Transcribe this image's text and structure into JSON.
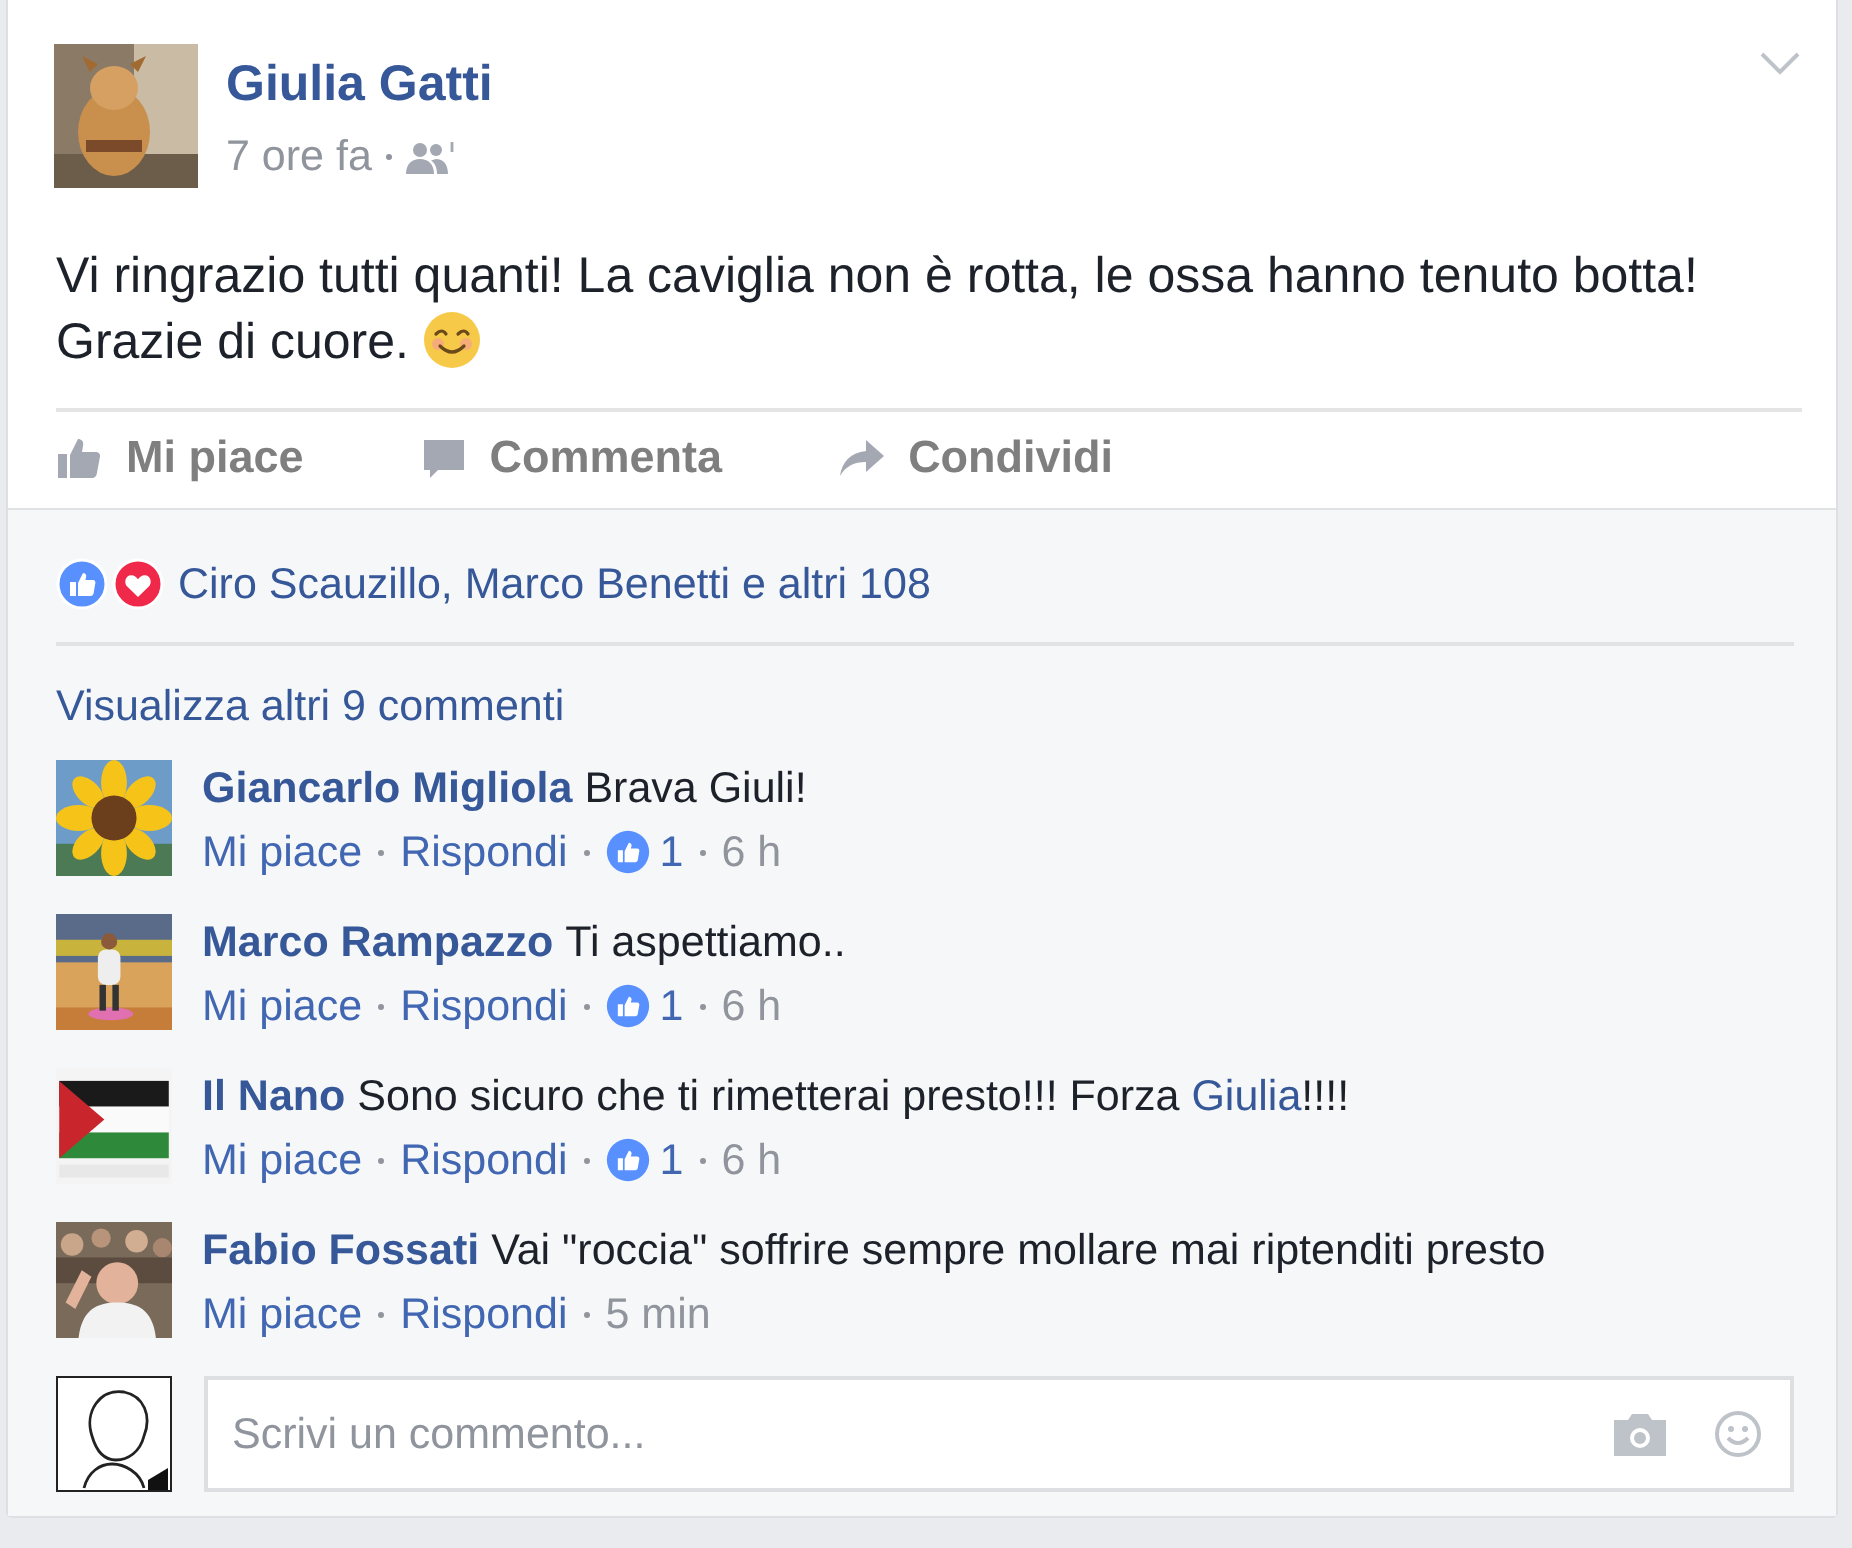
{
  "post": {
    "author": "Giulia Gatti",
    "time": "7 ore fa",
    "text": "Vi ringrazio tutti quanti! La caviglia non è rotta, le ossa hanno tenuto botta! Grazie di cuore.",
    "actions": [
      {
        "label": "Mi piace",
        "kind": "like"
      },
      {
        "label": "Commenta",
        "kind": "comment"
      },
      {
        "label": "Condividi",
        "kind": "share"
      }
    ]
  },
  "reactions": {
    "icons": [
      {
        "kind": "like"
      },
      {
        "kind": "love"
      }
    ],
    "summary": "Ciro Scauzillo, Marco Benetti e altri 108"
  },
  "more_comments": "Visualizza altri 9 commenti",
  "comments": [
    {
      "author": "Giancarlo Migliola",
      "text": [
        {
          "text": "Brava Giuli!"
        }
      ],
      "like_label": "Mi piace",
      "reply_label": "Rispondi",
      "likes": "1",
      "time": "6 h"
    },
    {
      "author": "Marco Rampazzo",
      "text": [
        {
          "text": "Ti aspettiamo.."
        }
      ],
      "like_label": "Mi piace",
      "reply_label": "Rispondi",
      "likes": "1",
      "time": "6 h"
    },
    {
      "author": "Il Nano",
      "text": [
        {
          "text": "Sono sicuro che ti rimetterai presto!!! Forza "
        },
        {
          "text": "Giulia",
          "kind": "mention"
        },
        {
          "text": "!!!!"
        }
      ],
      "like_label": "Mi piace",
      "reply_label": "Rispondi",
      "likes": "1",
      "time": "6 h"
    },
    {
      "author": "Fabio Fossati",
      "text": [
        {
          "text": "Vai \"roccia\" soffrire sempre mollare mai riptenditi presto"
        }
      ],
      "like_label": "Mi piace",
      "reply_label": "Rispondi",
      "time": "5 min"
    }
  ],
  "comment_box": {
    "placeholder": "Scrivi un commento..."
  }
}
